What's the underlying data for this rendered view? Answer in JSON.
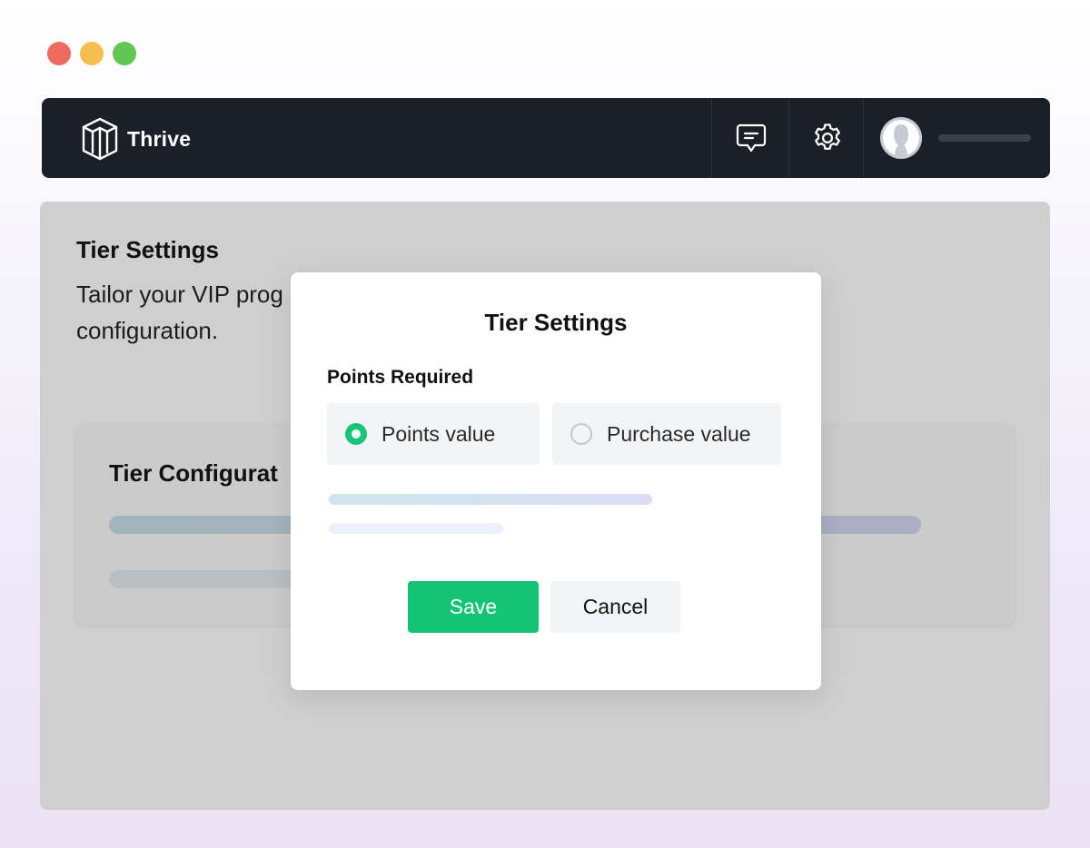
{
  "window": {
    "controls": [
      {
        "name": "close",
        "color": "#ee6a5f"
      },
      {
        "name": "minimize",
        "color": "#f5be4f"
      },
      {
        "name": "maximize",
        "color": "#62c554"
      }
    ]
  },
  "header": {
    "app_name": "Thrive",
    "icons": [
      "chat-icon",
      "gear-icon",
      "user-avatar-icon"
    ]
  },
  "page": {
    "title": "Tier Settings",
    "description": "Tailor your VIP prog",
    "description_cont": "configuration.",
    "card_title": "Tier Configurat"
  },
  "modal": {
    "title": "Tier Settings",
    "field_label": "Points Required",
    "options": [
      {
        "label": "Points value",
        "checked": true
      },
      {
        "label": "Purchase value",
        "checked": false
      }
    ],
    "save_label": "Save",
    "cancel_label": "Cancel"
  },
  "colors": {
    "accent": "#13c476",
    "header_bg": "#1b1f27",
    "overlay": "#cfcfcf"
  }
}
